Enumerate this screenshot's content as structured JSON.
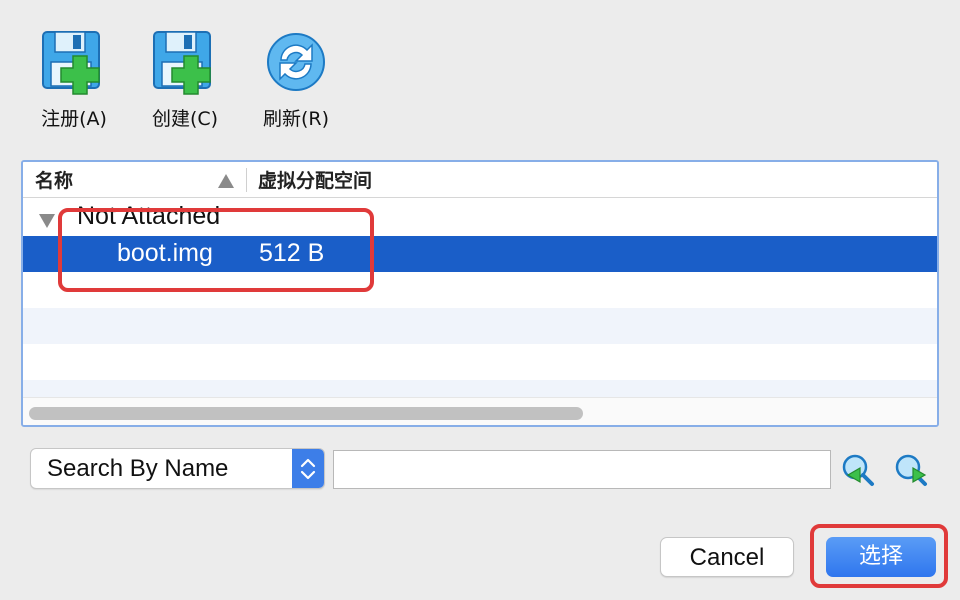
{
  "toolbar": {
    "register_label": "注册(A)",
    "create_label": "创建(C)",
    "refresh_label": "刷新(R)"
  },
  "table": {
    "columns": [
      "名称",
      "虚拟分配空间"
    ],
    "sort_column": "名称",
    "sort_direction": "ascending",
    "group_label": "Not Attached",
    "rows": [
      {
        "name": "boot.img",
        "size": "512 B",
        "selected": true
      }
    ]
  },
  "search": {
    "mode": "Search By Name",
    "query": ""
  },
  "buttons": {
    "cancel_label": "Cancel",
    "choose_label": "选择"
  },
  "colors": {
    "selection": "#1a5ec8",
    "accent": "#3d7ee8",
    "highlight": "#e03a3a"
  },
  "icons": {
    "register": "floppy-plus-icon",
    "create": "floppy-plus-icon",
    "refresh": "refresh-icon",
    "search_prev": "search-prev-icon",
    "search_next": "search-next-icon"
  }
}
